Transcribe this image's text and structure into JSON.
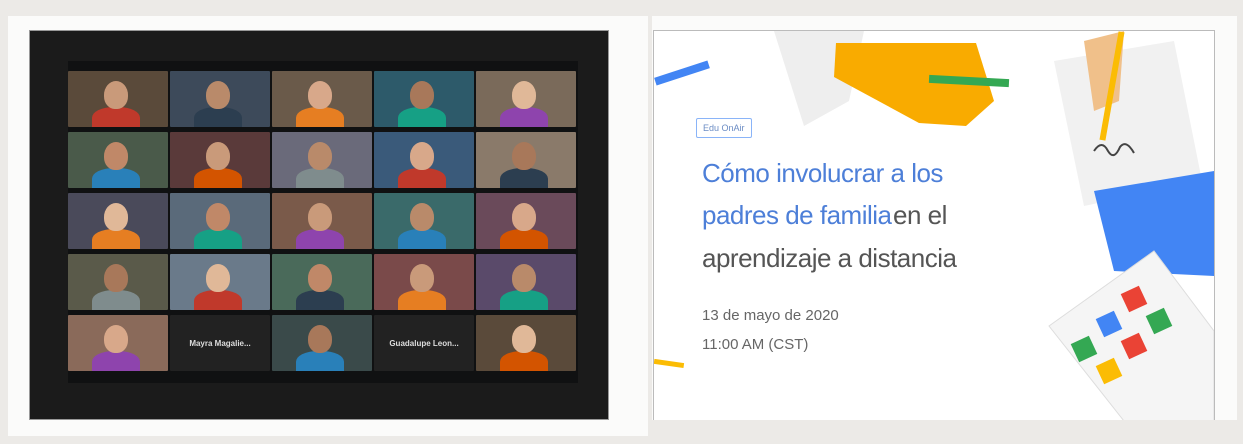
{
  "left_photo": {
    "name_tiles": [
      "Mayra Magalie...",
      "Guadalupe Leon..."
    ]
  },
  "slide": {
    "badge": "Edu OnAir",
    "title_line1": "Cómo involucrar a los",
    "title_line2_highlight": "padres de familia",
    "title_line2_rest": "en el",
    "title_line3": "aprendizaje a distancia",
    "date": "13 de mayo de 2020",
    "time": "11:00 AM (CST)",
    "colors": {
      "blue": "#4d7fd8",
      "yellow": "#fbbc04",
      "green": "#34a853",
      "red": "#ea4335",
      "text_gray": "#555555"
    }
  }
}
